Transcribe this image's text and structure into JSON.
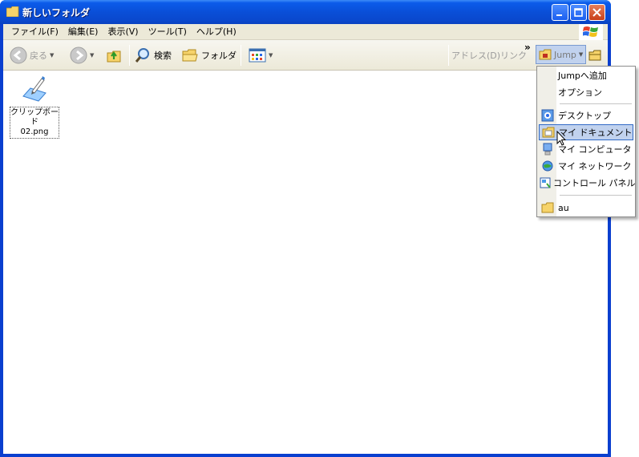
{
  "window": {
    "title": "新しいフォルダ"
  },
  "menubar": {
    "items": [
      "ファイル(F)",
      "編集(E)",
      "表示(V)",
      "ツール(T)",
      "ヘルプ(H)"
    ]
  },
  "toolbar": {
    "back_label": "戻る",
    "search_label": "検索",
    "folders_label": "フォルダ",
    "address_label": "アドレス(D)",
    "links_label": "リンク",
    "overflow_label": "»",
    "jump_label": "Jump"
  },
  "content": {
    "file": {
      "name_line1": "クリップボード",
      "name_line2": "02.png"
    }
  },
  "jump_menu": {
    "items": [
      {
        "label": "Jumpへ追加",
        "icon": "none"
      },
      {
        "label": "オプション",
        "icon": "none"
      },
      {
        "label": "デスクトップ",
        "icon": "desktop-icon"
      },
      {
        "label": "マイ ドキュメント",
        "icon": "my-documents-icon",
        "selected": true
      },
      {
        "label": "マイ コンピュータ",
        "icon": "my-computer-icon"
      },
      {
        "label": "マイ ネットワーク",
        "icon": "my-network-icon"
      },
      {
        "label": "コントロール パネル",
        "icon": "control-panel-icon"
      },
      {
        "label": "au",
        "icon": "folder-icon"
      }
    ]
  },
  "colors": {
    "titlebar": "#0a4fd8",
    "menu_highlight": "#c1d2ee",
    "toolbar_bg": "#ece9d8"
  }
}
